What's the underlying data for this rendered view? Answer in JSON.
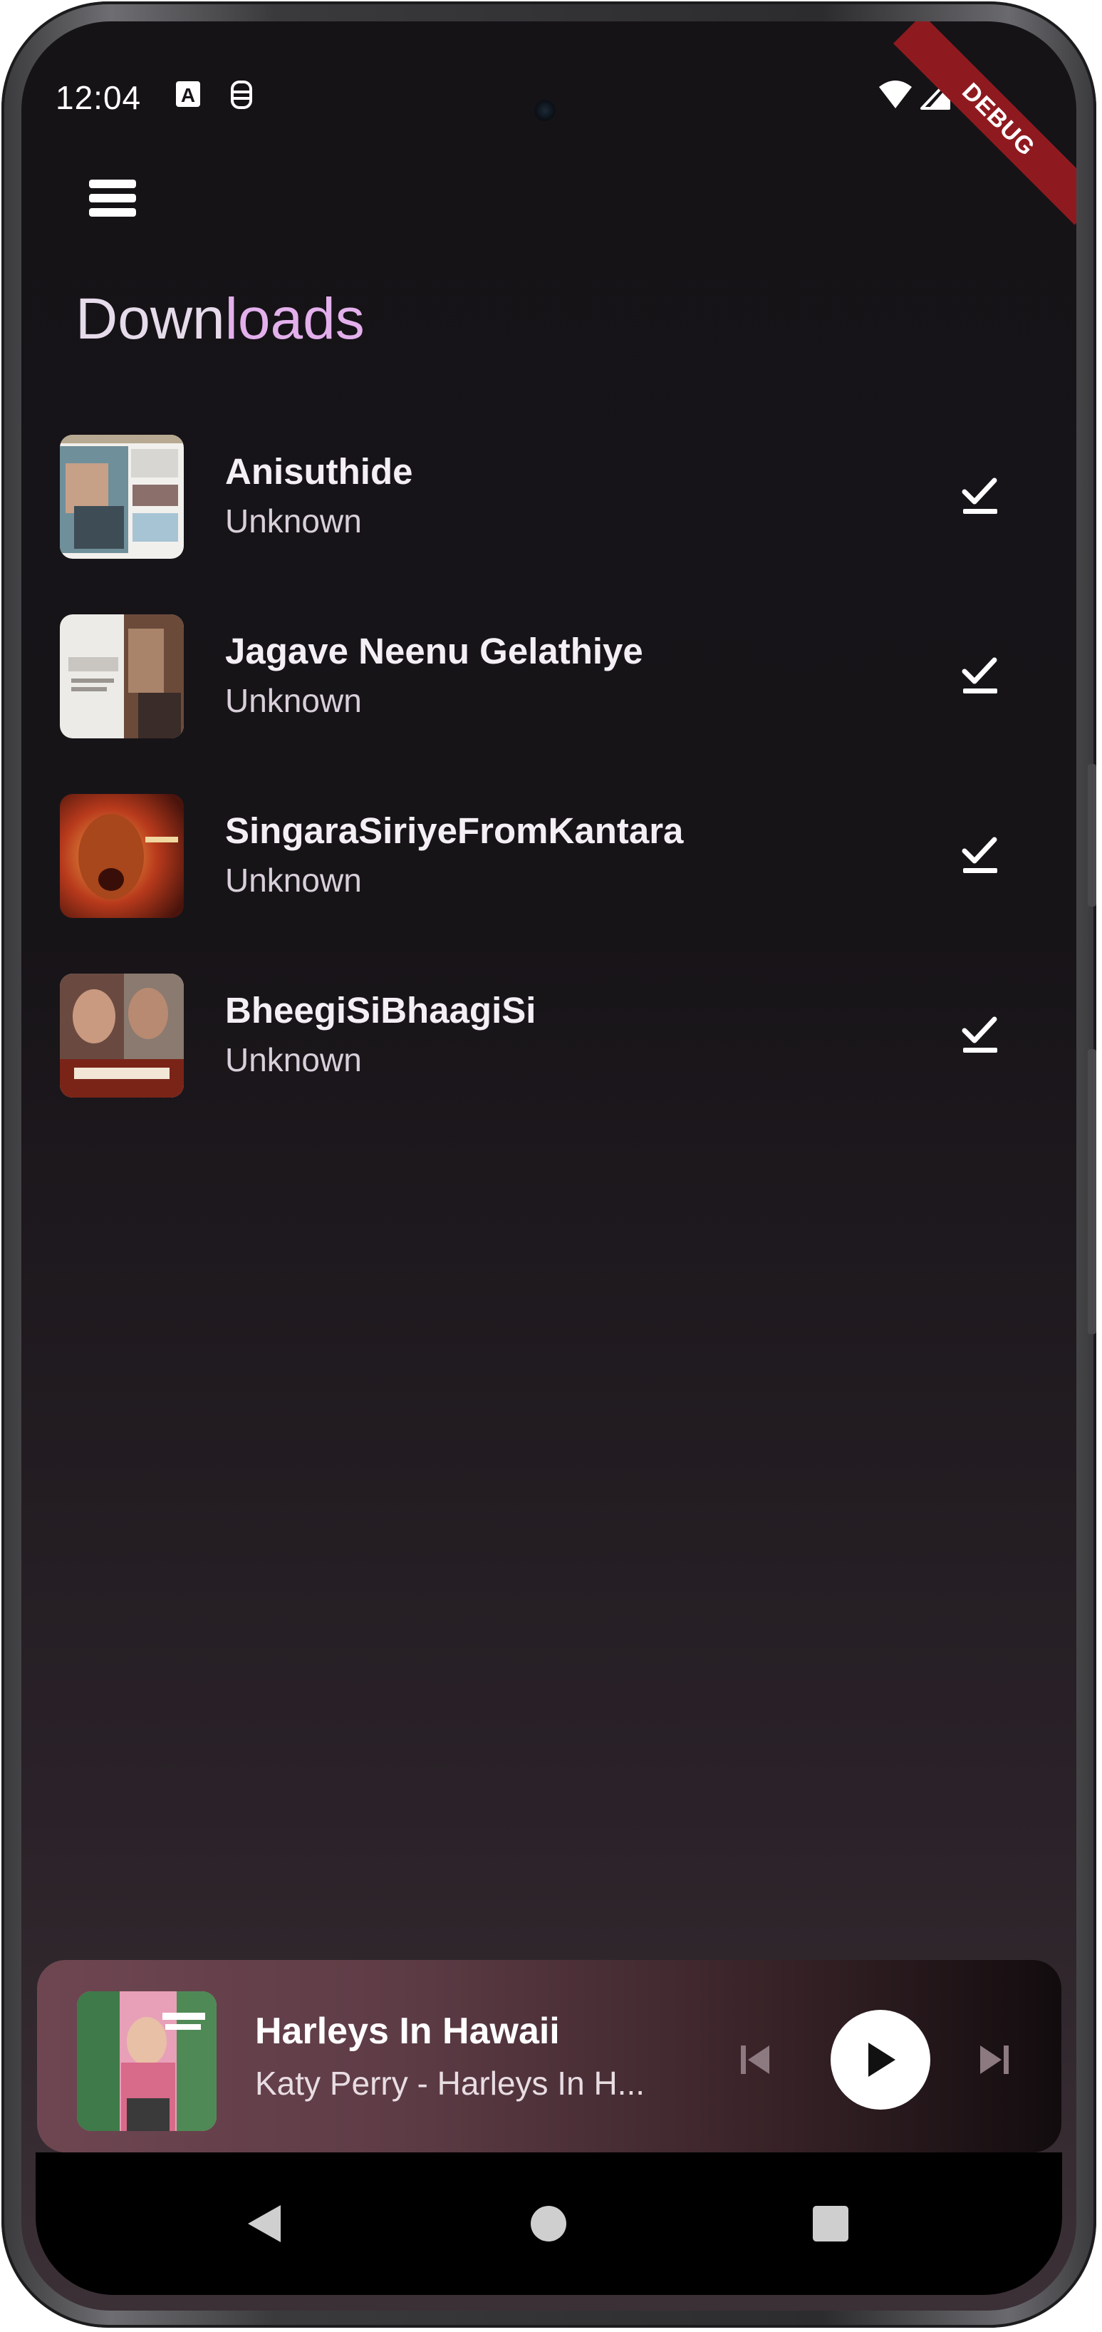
{
  "status_bar": {
    "time": "12:04",
    "icons": [
      "font-a-icon",
      "sim-icon",
      "wifi-icon",
      "cellular-signal-icon",
      "battery-icon"
    ]
  },
  "debug_banner": "DEBUG",
  "header": {
    "menu_icon": "hamburger-menu-icon",
    "title_part1": "Down",
    "title_part2": "loads"
  },
  "downloads": [
    {
      "title": "Anisuthide",
      "subtitle": "Unknown",
      "status_icon": "download-done-icon"
    },
    {
      "title": "Jagave Neenu Gelathiye",
      "subtitle": "Unknown",
      "status_icon": "download-done-icon"
    },
    {
      "title": "SingaraSiriyeFromKantara",
      "subtitle": "Unknown",
      "status_icon": "download-done-icon"
    },
    {
      "title": "BheegiSiBhaagiSi",
      "subtitle": "Unknown",
      "status_icon": "download-done-icon"
    }
  ],
  "now_playing": {
    "title": "Harleys In Hawaii",
    "artist": "Katy Perry - Harleys In H...",
    "controls": [
      "skip-previous-icon",
      "play-icon",
      "skip-next-icon"
    ]
  },
  "navigation_bar": [
    "back-icon",
    "home-icon",
    "recents-icon"
  ],
  "colors": {
    "background": "#171418",
    "title_plain": "#e6dbea",
    "title_accent": "#e3b0ec",
    "debug_banner": "#8e1a1f",
    "mini_player_start": "#6e4651",
    "mini_player_end": "#120c0e"
  }
}
